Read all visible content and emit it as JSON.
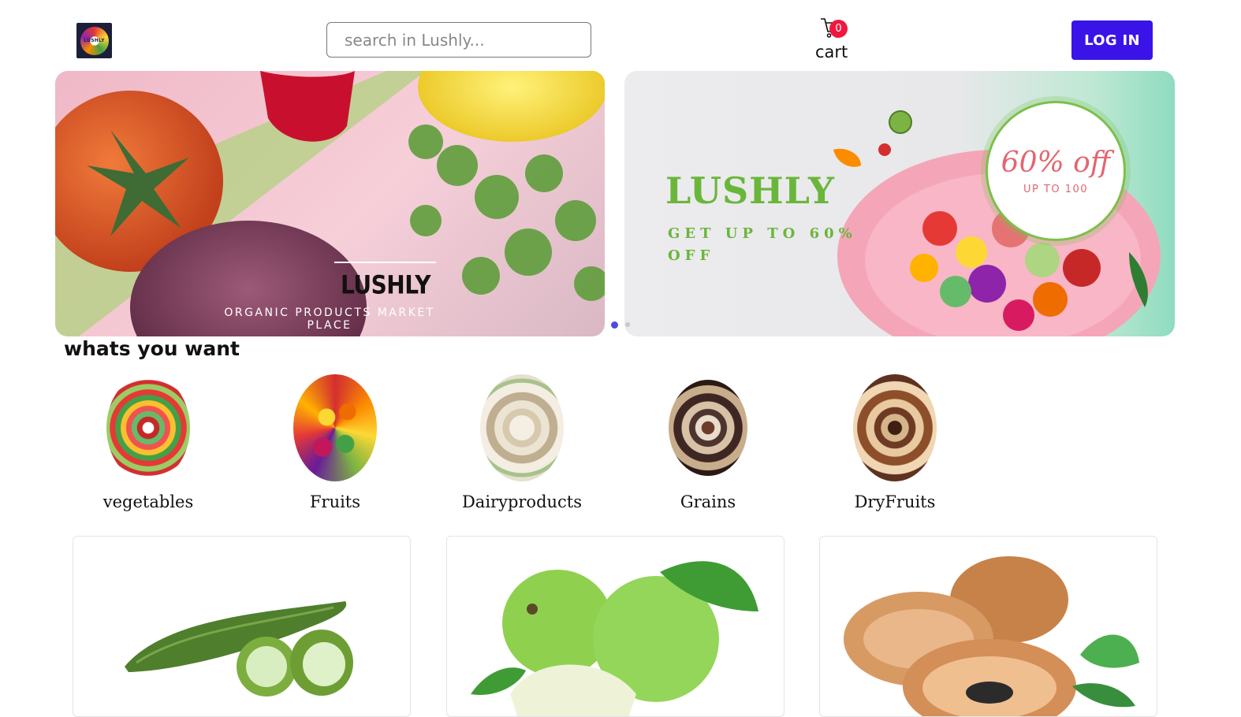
{
  "header": {
    "logo_text": "LUSHLY",
    "search_placeholder": "search in Lushly...",
    "cart_label": "cart",
    "cart_count": "0",
    "login_label": "LOG IN"
  },
  "carousel": {
    "slides": [
      {
        "title": "LUSHLY",
        "subtitle": "ORGANIC PRODUCTS MARKET PLACE"
      },
      {
        "brand": "LUSHLY",
        "offer": "GET UP TO 60% OFF",
        "badge_main": "60% off",
        "badge_sub": "UP TO 100"
      }
    ],
    "active_index": 0
  },
  "categories": {
    "title": "whats you want",
    "items": [
      {
        "label": "vegetables"
      },
      {
        "label": "Fruits"
      },
      {
        "label": "Dairyproducts"
      },
      {
        "label": "Grains"
      },
      {
        "label": "DryFruits"
      }
    ]
  },
  "products": {
    "items": [
      {
        "image": "ridge-gourd-image"
      },
      {
        "image": "guava-image"
      },
      {
        "image": "sapota-image"
      }
    ]
  },
  "colors": {
    "accent": "#3a13e8",
    "badge": "#f0183e",
    "brand_green": "#6ab63a",
    "offer_pink": "#e36570"
  }
}
